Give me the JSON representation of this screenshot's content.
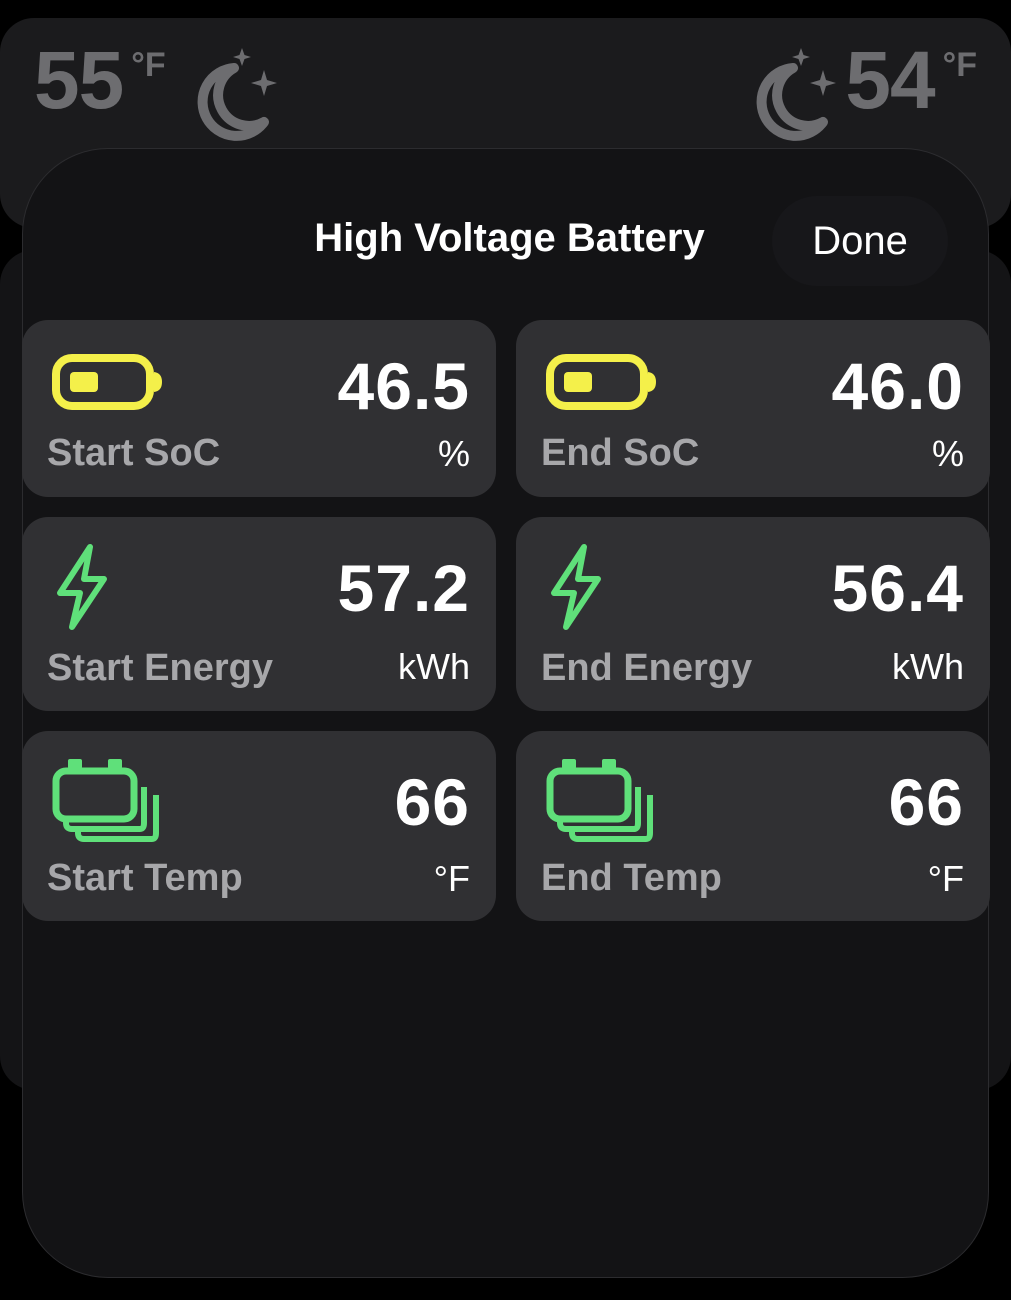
{
  "background": {
    "left_weather": {
      "temp": "55",
      "unit": "°F",
      "icon": "moon-stars-icon"
    },
    "right_weather": {
      "temp": "54",
      "unit": "°F",
      "icon": "moon-stars-icon"
    }
  },
  "sheet": {
    "title": "High Voltage Battery",
    "done_label": "Done"
  },
  "colors": {
    "battery_soc": "#f4f04a",
    "energy_green": "#5fe07a",
    "temp_green": "#5fe07a"
  },
  "tiles": [
    {
      "label": "Start SoC",
      "value": "46.5",
      "unit": "%",
      "icon": "battery-icon"
    },
    {
      "label": "End SoC",
      "value": "46.0",
      "unit": "%",
      "icon": "battery-icon"
    },
    {
      "label": "Start Energy",
      "value": "57.2",
      "unit": "kWh",
      "icon": "bolt-icon"
    },
    {
      "label": "End Energy",
      "value": "56.4",
      "unit": "kWh",
      "icon": "bolt-icon"
    },
    {
      "label": "Start Temp",
      "value": "66",
      "unit": "°F",
      "icon": "battery-stack-icon"
    },
    {
      "label": "End Temp",
      "value": "66",
      "unit": "°F",
      "icon": "battery-stack-icon"
    }
  ]
}
